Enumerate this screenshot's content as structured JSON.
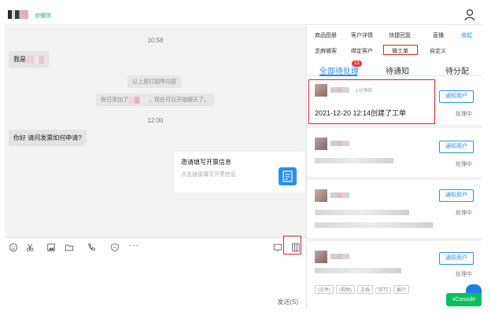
{
  "header": {
    "wechat_tag": "@微信"
  },
  "chat": {
    "time1": "10:58",
    "msg1": "我是",
    "sys1": "以上是打招呼内容",
    "sys2_prefix": "你已添加了",
    "sys2_suffix": "，现在可以开始聊天了。",
    "time2": "12:00",
    "msg2": "你好 请问发票如何申请?",
    "card_title": "邀请填写开票信息",
    "card_sub": "点击链接填写开票信息"
  },
  "composer": {
    "send_label": "发送(S)"
  },
  "right_panel": {
    "tabs_row1": [
      "商品图册",
      "客户详情",
      "快捷回复",
      "直播",
      "收起"
    ],
    "tabs_row2": [
      "芝麻微客",
      "绑定客户",
      "微工单",
      "自定义"
    ],
    "subtabs": [
      "全部待处理",
      "待通知",
      "待分配"
    ],
    "badge": "13",
    "items": [
      {
        "time": "1分钟前",
        "text": "2021-12-20 12:14创建了工单",
        "button": "通知用户",
        "status": "处理中"
      },
      {
        "button": "通知用户",
        "status": "处理中"
      },
      {
        "button": "通知用户",
        "status": "处理中"
      },
      {
        "button": "通知用户",
        "status": "处理中"
      }
    ],
    "chips": [
      "(文件)",
      "(视频)",
      "文档",
      "(ET)",
      "银行"
    ]
  },
  "vconsole": "vConsole",
  "colors": {
    "accent": "#2b8ef0",
    "highlight": "#d9242b",
    "wechat_green": "#26a65b"
  }
}
